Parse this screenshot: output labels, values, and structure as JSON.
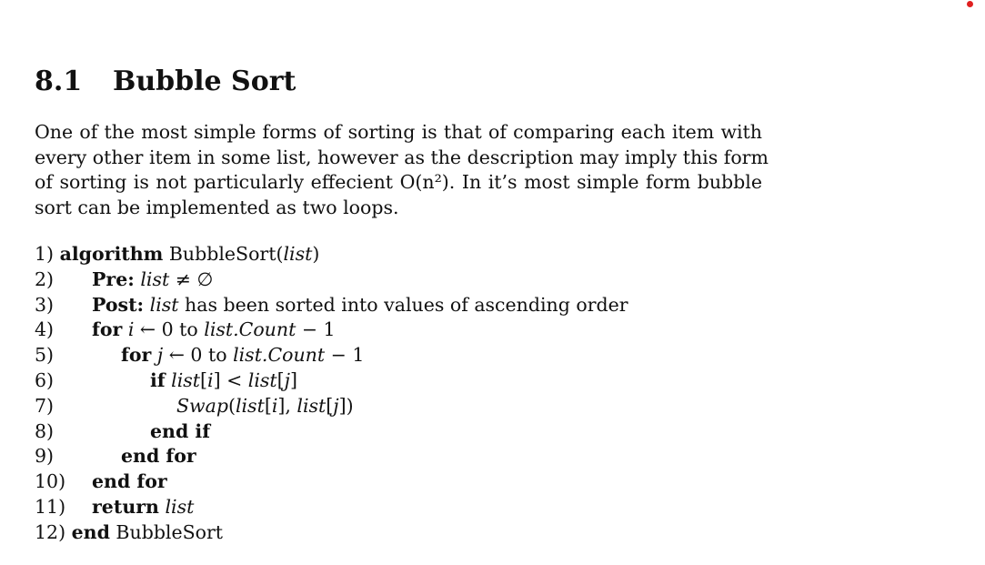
{
  "section": {
    "number": "8.1",
    "title": "Bubble Sort"
  },
  "paragraph_lines": [
    "One of the most simple forms of sorting is that of comparing each item with",
    "every other item in some list, however as the description may imply this form",
    "of sorting is not particularly effecient O(n²). In it’s most simple form bubble",
    "sort can be implemented as two loops."
  ],
  "algorithm": [
    {
      "num": "1)",
      "indent": 0,
      "parts": [
        [
          "kw",
          "algorithm"
        ],
        [
          "",
          " BubbleSort("
        ],
        [
          "it",
          "list"
        ],
        [
          "",
          ")"
        ]
      ]
    },
    {
      "num": "2)",
      "indent": 1,
      "parts": [
        [
          "kw",
          "Pre:"
        ],
        [
          "",
          " "
        ],
        [
          "it",
          "list"
        ],
        [
          "",
          " ≠ ∅"
        ]
      ]
    },
    {
      "num": "3)",
      "indent": 1,
      "parts": [
        [
          "kw",
          "Post:"
        ],
        [
          "",
          " "
        ],
        [
          "it",
          "list"
        ],
        [
          "",
          " has been sorted into values of ascending order"
        ]
      ]
    },
    {
      "num": "4)",
      "indent": 1,
      "parts": [
        [
          "kw",
          "for"
        ],
        [
          "",
          " "
        ],
        [
          "it",
          "i"
        ],
        [
          "",
          " ← 0 to "
        ],
        [
          "it",
          "list.Count"
        ],
        [
          "",
          " − 1"
        ]
      ]
    },
    {
      "num": "5)",
      "indent": 2,
      "parts": [
        [
          "kw",
          "for"
        ],
        [
          "",
          " "
        ],
        [
          "it",
          "j"
        ],
        [
          "",
          " ← 0 to "
        ],
        [
          "it",
          "list.Count"
        ],
        [
          "",
          " − 1"
        ]
      ]
    },
    {
      "num": "6)",
      "indent": 3,
      "parts": [
        [
          "kw",
          "if"
        ],
        [
          "",
          " "
        ],
        [
          "it",
          "list"
        ],
        [
          "",
          "["
        ],
        [
          "it",
          "i"
        ],
        [
          "",
          "] < "
        ],
        [
          "it",
          "list"
        ],
        [
          "",
          "["
        ],
        [
          "it",
          "j"
        ],
        [
          "",
          "]"
        ]
      ]
    },
    {
      "num": "7)",
      "indent": 4,
      "parts": [
        [
          "it",
          "Swap"
        ],
        [
          "",
          "("
        ],
        [
          "it",
          "list"
        ],
        [
          "",
          "["
        ],
        [
          "it",
          "i"
        ],
        [
          "",
          "], "
        ],
        [
          "it",
          "list"
        ],
        [
          "",
          "["
        ],
        [
          "it",
          "j"
        ],
        [
          "",
          "])"
        ]
      ]
    },
    {
      "num": "8)",
      "indent": 3,
      "parts": [
        [
          "kw",
          "end if"
        ]
      ]
    },
    {
      "num": "9)",
      "indent": 2,
      "parts": [
        [
          "kw",
          "end for"
        ]
      ]
    },
    {
      "num": "10)",
      "indent": 1,
      "parts": [
        [
          "kw",
          "end for"
        ]
      ]
    },
    {
      "num": "11)",
      "indent": 1,
      "parts": [
        [
          "kw",
          "return"
        ],
        [
          "",
          " "
        ],
        [
          "it",
          "list"
        ]
      ]
    },
    {
      "num": "12)",
      "indent": 0,
      "parts": [
        [
          "kw",
          "end"
        ],
        [
          "",
          " BubbleSort"
        ]
      ]
    }
  ]
}
